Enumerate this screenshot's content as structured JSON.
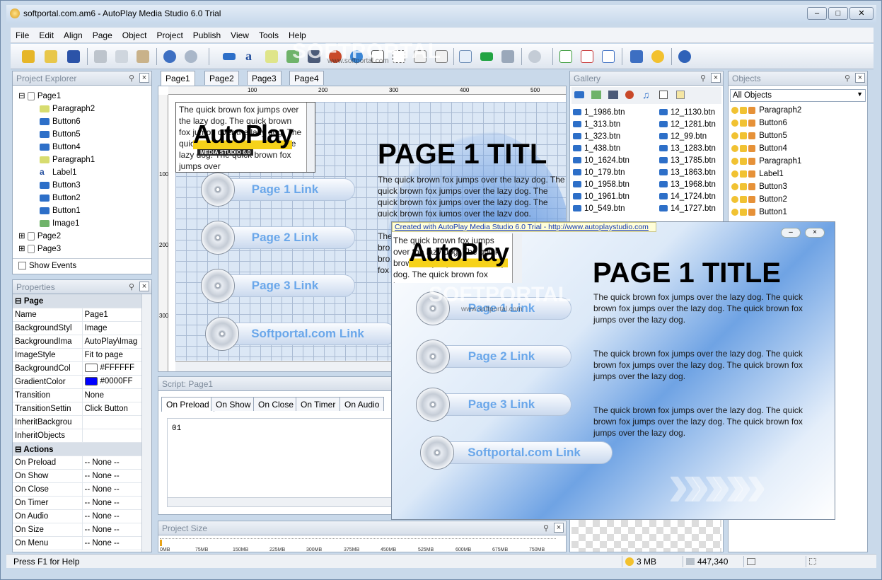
{
  "window": {
    "title": "softportal.com.am6 - AutoPlay Media Studio 6.0 Trial"
  },
  "menu": [
    "File",
    "Edit",
    "Align",
    "Page",
    "Object",
    "Project",
    "Publish",
    "View",
    "Tools",
    "Help"
  ],
  "watermark": {
    "brand": "SOFTPORTAL",
    "url": "www.softportal.com"
  },
  "project_explorer": {
    "title": "Project Explorer",
    "root": "Page1",
    "children": [
      "Paragraph2",
      "Button6",
      "Button5",
      "Button4",
      "Paragraph1",
      "Label1",
      "Button3",
      "Button2",
      "Button1",
      "Image1"
    ],
    "pages": [
      "Page2",
      "Page3"
    ],
    "show_events": "Show Events"
  },
  "properties": {
    "title": "Properties",
    "section_page": "Page",
    "rows": [
      [
        "Name",
        "Page1"
      ],
      [
        "BackgroundStyl",
        "Image"
      ],
      [
        "BackgroundIma",
        "AutoPlay\\Imag"
      ],
      [
        "ImageStyle",
        "Fit to page"
      ],
      [
        "BackgroundCol",
        "#FFFFFF"
      ],
      [
        "GradientColor",
        "#0000FF"
      ],
      [
        "Transition",
        "None"
      ],
      [
        "TransitionSettin",
        "Click Button"
      ],
      [
        "InheritBackgrou",
        ""
      ],
      [
        "InheritObjects",
        ""
      ]
    ],
    "section_actions": "Actions",
    "actions": [
      [
        "On Preload",
        "-- None --"
      ],
      [
        "On Show",
        "-- None --"
      ],
      [
        "On Close",
        "-- None --"
      ],
      [
        "On Timer",
        "-- None --"
      ],
      [
        "On Audio",
        "-- None --"
      ],
      [
        "On Size",
        "-- None --"
      ],
      [
        "On Menu",
        "-- None --"
      ]
    ],
    "colors": {
      "bg": "#FFFFFF",
      "grad": "#0000FF"
    }
  },
  "doc_tabs": [
    "Page1",
    "Page2",
    "Page3",
    "Page4"
  ],
  "ruler": {
    "marks": [
      "100",
      "200",
      "300",
      "400",
      "500"
    ],
    "vmarks": [
      "100",
      "200",
      "300"
    ]
  },
  "page": {
    "title": "PAGE 1 TITL",
    "para": "The quick brown fox jumps over the lazy dog. The quick brown fox jumps over the lazy dog. The quick brown fox jumps over the lazy dog. The quick brown fox jumps over the lazy dog.",
    "para_short": "The quick brown fox jumps over the lazy dog. The quick brown fox jumps over the lazy dog. The quick brown fox jumps over the lazy dog. The quick brown fox jumps over",
    "logo": "AutoPlay",
    "logo_sub": "MEDIA STUDIO 6.0",
    "links": [
      "Page 1 Link",
      "Page 2 Link",
      "Page 3 Link",
      "Softportal.com Link"
    ],
    "frag_lines": [
      "The",
      "bro",
      "bro",
      "fox"
    ]
  },
  "script": {
    "title": "Script: Page1",
    "tabs": [
      "On Preload",
      "On Show",
      "On Close",
      "On Timer",
      "On Audio"
    ],
    "line": "01"
  },
  "project_size": {
    "title": "Project Size",
    "marks": [
      "0MB",
      "75MB",
      "150MB",
      "225MB",
      "300MB",
      "375MB",
      "450MB",
      "525MB",
      "600MB",
      "675MB",
      "750MB"
    ]
  },
  "gallery": {
    "title": "Gallery",
    "col1": [
      "1_1986.btn",
      "1_313.btn",
      "1_323.btn",
      "1_438.btn",
      "10_1624.btn",
      "10_179.btn",
      "10_1958.btn",
      "10_1961.btn",
      "10_549.btn"
    ],
    "col2": [
      "12_1130.btn",
      "12_1281.btn",
      "12_99.btn",
      "13_1283.btn",
      "13_1785.btn",
      "13_1863.btn",
      "13_1968.btn",
      "14_1724.btn",
      "14_1727.btn"
    ]
  },
  "objects": {
    "title": "Objects",
    "filter": "All Objects",
    "items": [
      "Paragraph2",
      "Button6",
      "Button5",
      "Button4",
      "Paragraph1",
      "Label1",
      "Button3",
      "Button2",
      "Button1"
    ]
  },
  "preview": {
    "banner": "Created with AutoPlay Media Studio 6.0 Trial - http://www.autoplaystudio.com",
    "title": "PAGE 1 TITLE",
    "para": "The quick brown fox jumps over the lazy dog. The quick brown fox jumps over the lazy dog. The quick brown fox jumps over the lazy dog.",
    "snip": "The quick brown fox jumps over the lazy dog. The quick brown fox jumps over the lazy dog. The quick brown fox jumps over",
    "links": [
      "Page 1 Link",
      "Page 2 Link",
      "Page 3 Link",
      "Softportal.com Link"
    ]
  },
  "status": {
    "help": "Press F1 for Help",
    "size": "3 MB",
    "coords": "447,340"
  }
}
